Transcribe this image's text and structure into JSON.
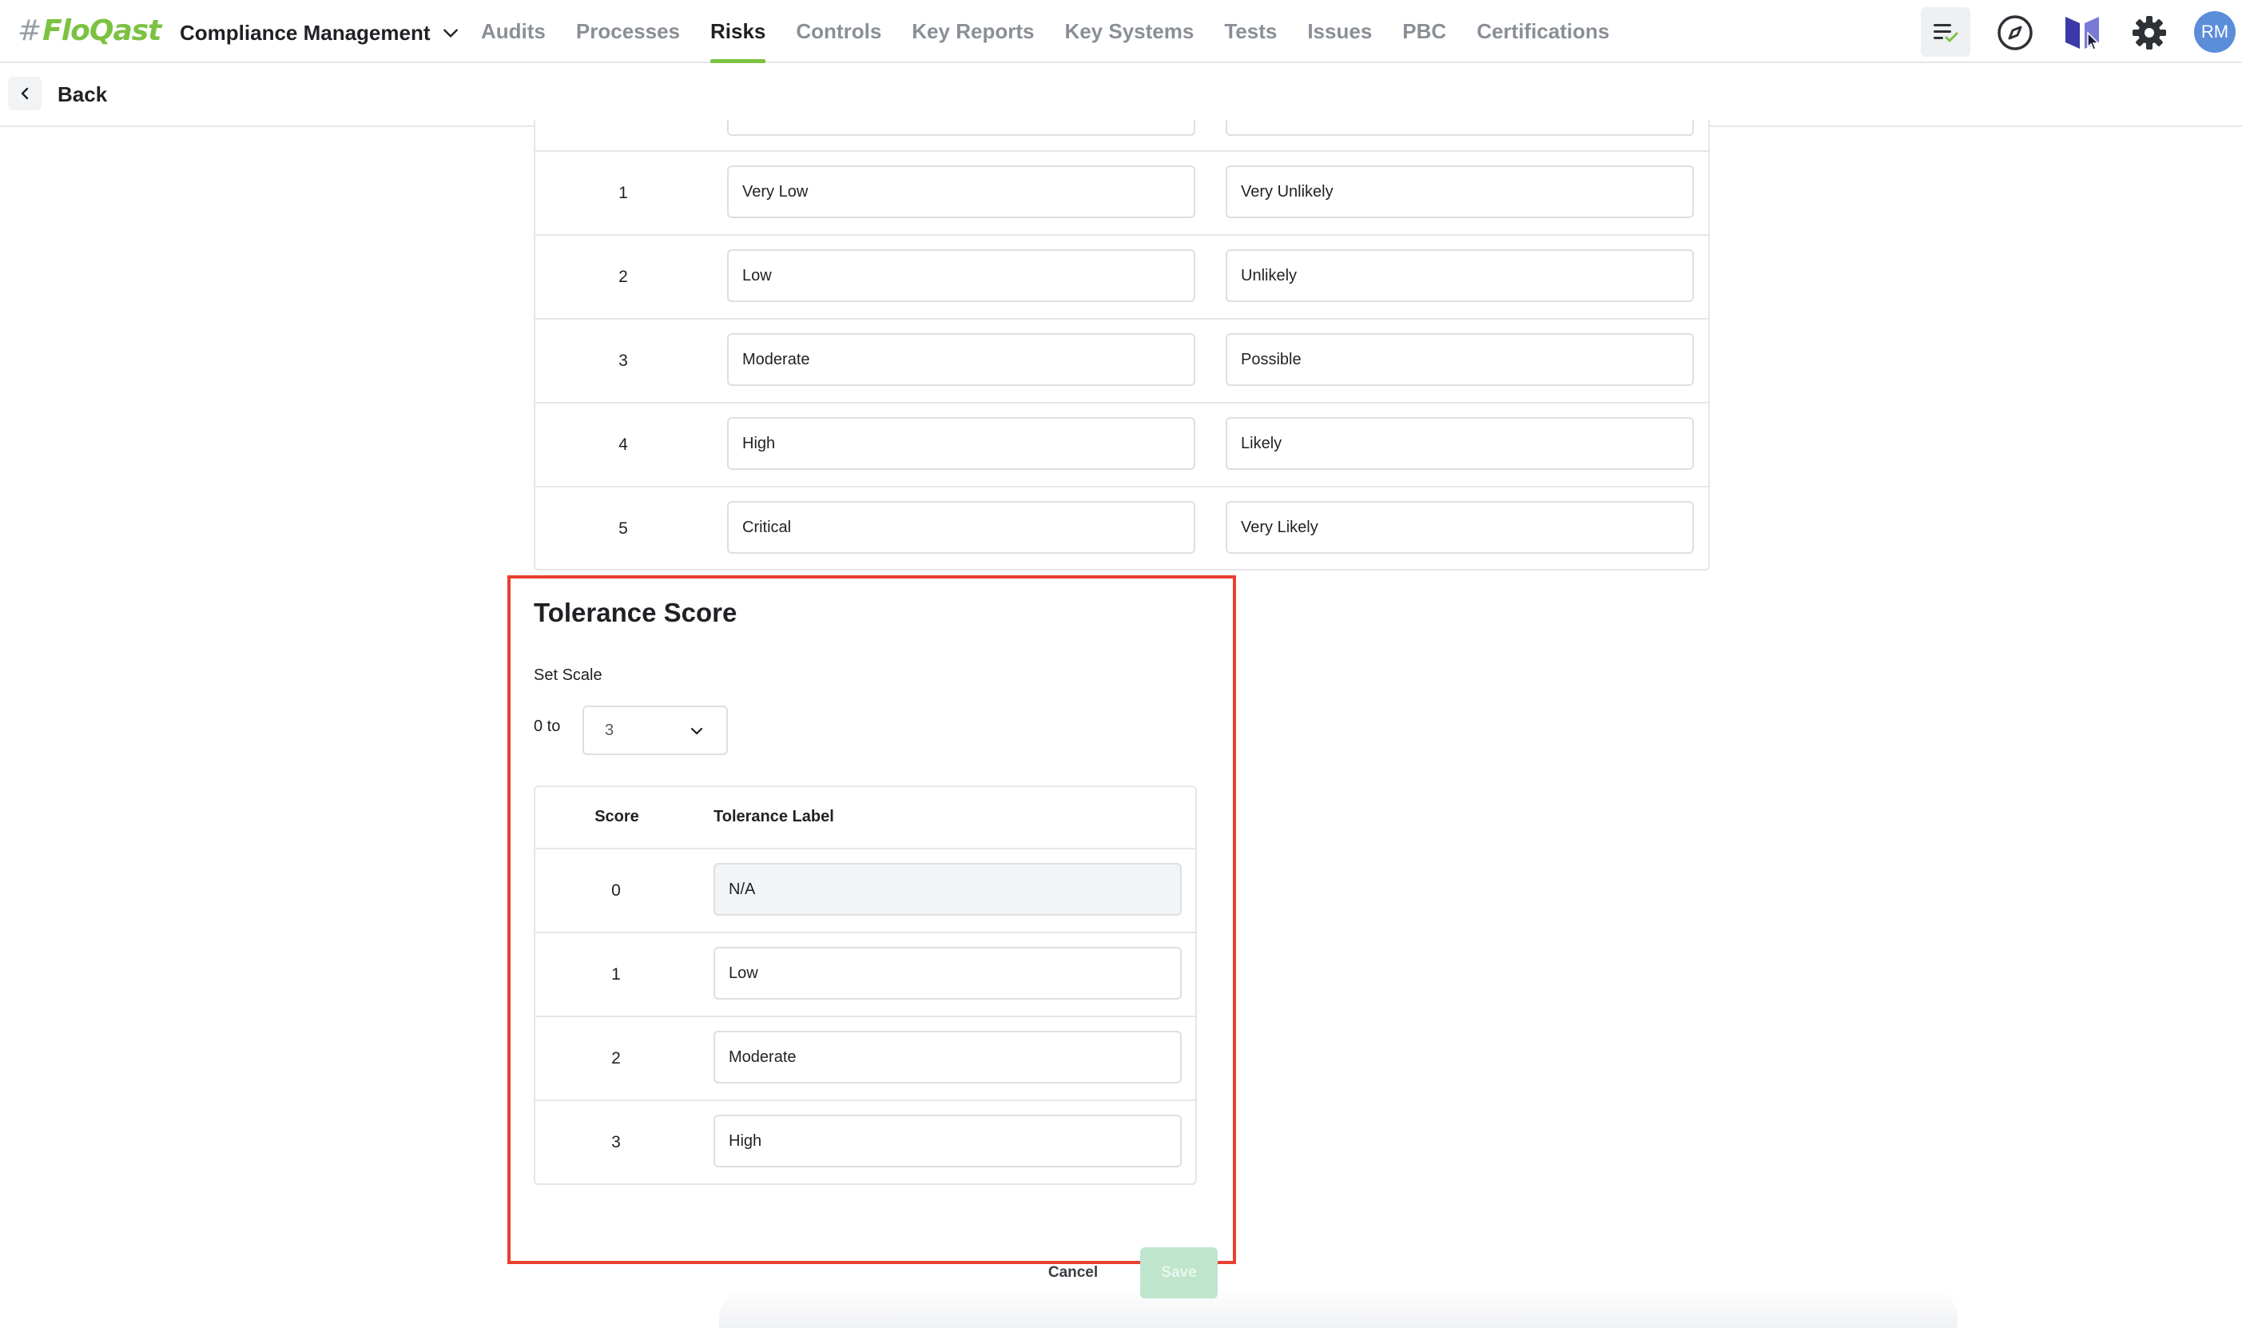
{
  "app": {
    "logo_hash": "#",
    "logo_text": "FloQast",
    "product": "Compliance Management"
  },
  "nav": {
    "tabs": [
      {
        "label": "Audits",
        "active": false
      },
      {
        "label": "Processes",
        "active": false
      },
      {
        "label": "Risks",
        "active": true
      },
      {
        "label": "Controls",
        "active": false
      },
      {
        "label": "Key Reports",
        "active": false
      },
      {
        "label": "Key Systems",
        "active": false
      },
      {
        "label": "Tests",
        "active": false
      },
      {
        "label": "Issues",
        "active": false
      },
      {
        "label": "PBC",
        "active": false
      },
      {
        "label": "Certifications",
        "active": false
      }
    ],
    "icons": [
      "tasks-list-icon",
      "compass-icon",
      "book-icon",
      "gear-icon"
    ],
    "avatar_initials": "RM"
  },
  "subheader": {
    "back_label": "Back"
  },
  "impact_likelihood": {
    "rows": [
      {
        "score": "1",
        "impact": "Very Low",
        "likelihood": "Very Unlikely"
      },
      {
        "score": "2",
        "impact": "Low",
        "likelihood": "Unlikely"
      },
      {
        "score": "3",
        "impact": "Moderate",
        "likelihood": "Possible"
      },
      {
        "score": "4",
        "impact": "High",
        "likelihood": "Likely"
      },
      {
        "score": "5",
        "impact": "Critical",
        "likelihood": "Very Likely"
      }
    ]
  },
  "tolerance": {
    "title": "Tolerance Score",
    "set_scale_label": "Set Scale",
    "range_prefix": "0 to",
    "scale_value": "3",
    "col_score": "Score",
    "col_label": "Tolerance Label",
    "rows": [
      {
        "score": "0",
        "label": "N/A",
        "readonly": true
      },
      {
        "score": "1",
        "label": "Low",
        "readonly": false
      },
      {
        "score": "2",
        "label": "Moderate",
        "readonly": false
      },
      {
        "score": "3",
        "label": "High",
        "readonly": false
      }
    ]
  },
  "actions": {
    "cancel_label": "Cancel",
    "save_label": "Save"
  },
  "colors": {
    "brand_green": "#7cc242",
    "highlight_red": "#e8412f",
    "save_disabled": "#bfe5cc",
    "avatar": "#5b8dd9"
  }
}
